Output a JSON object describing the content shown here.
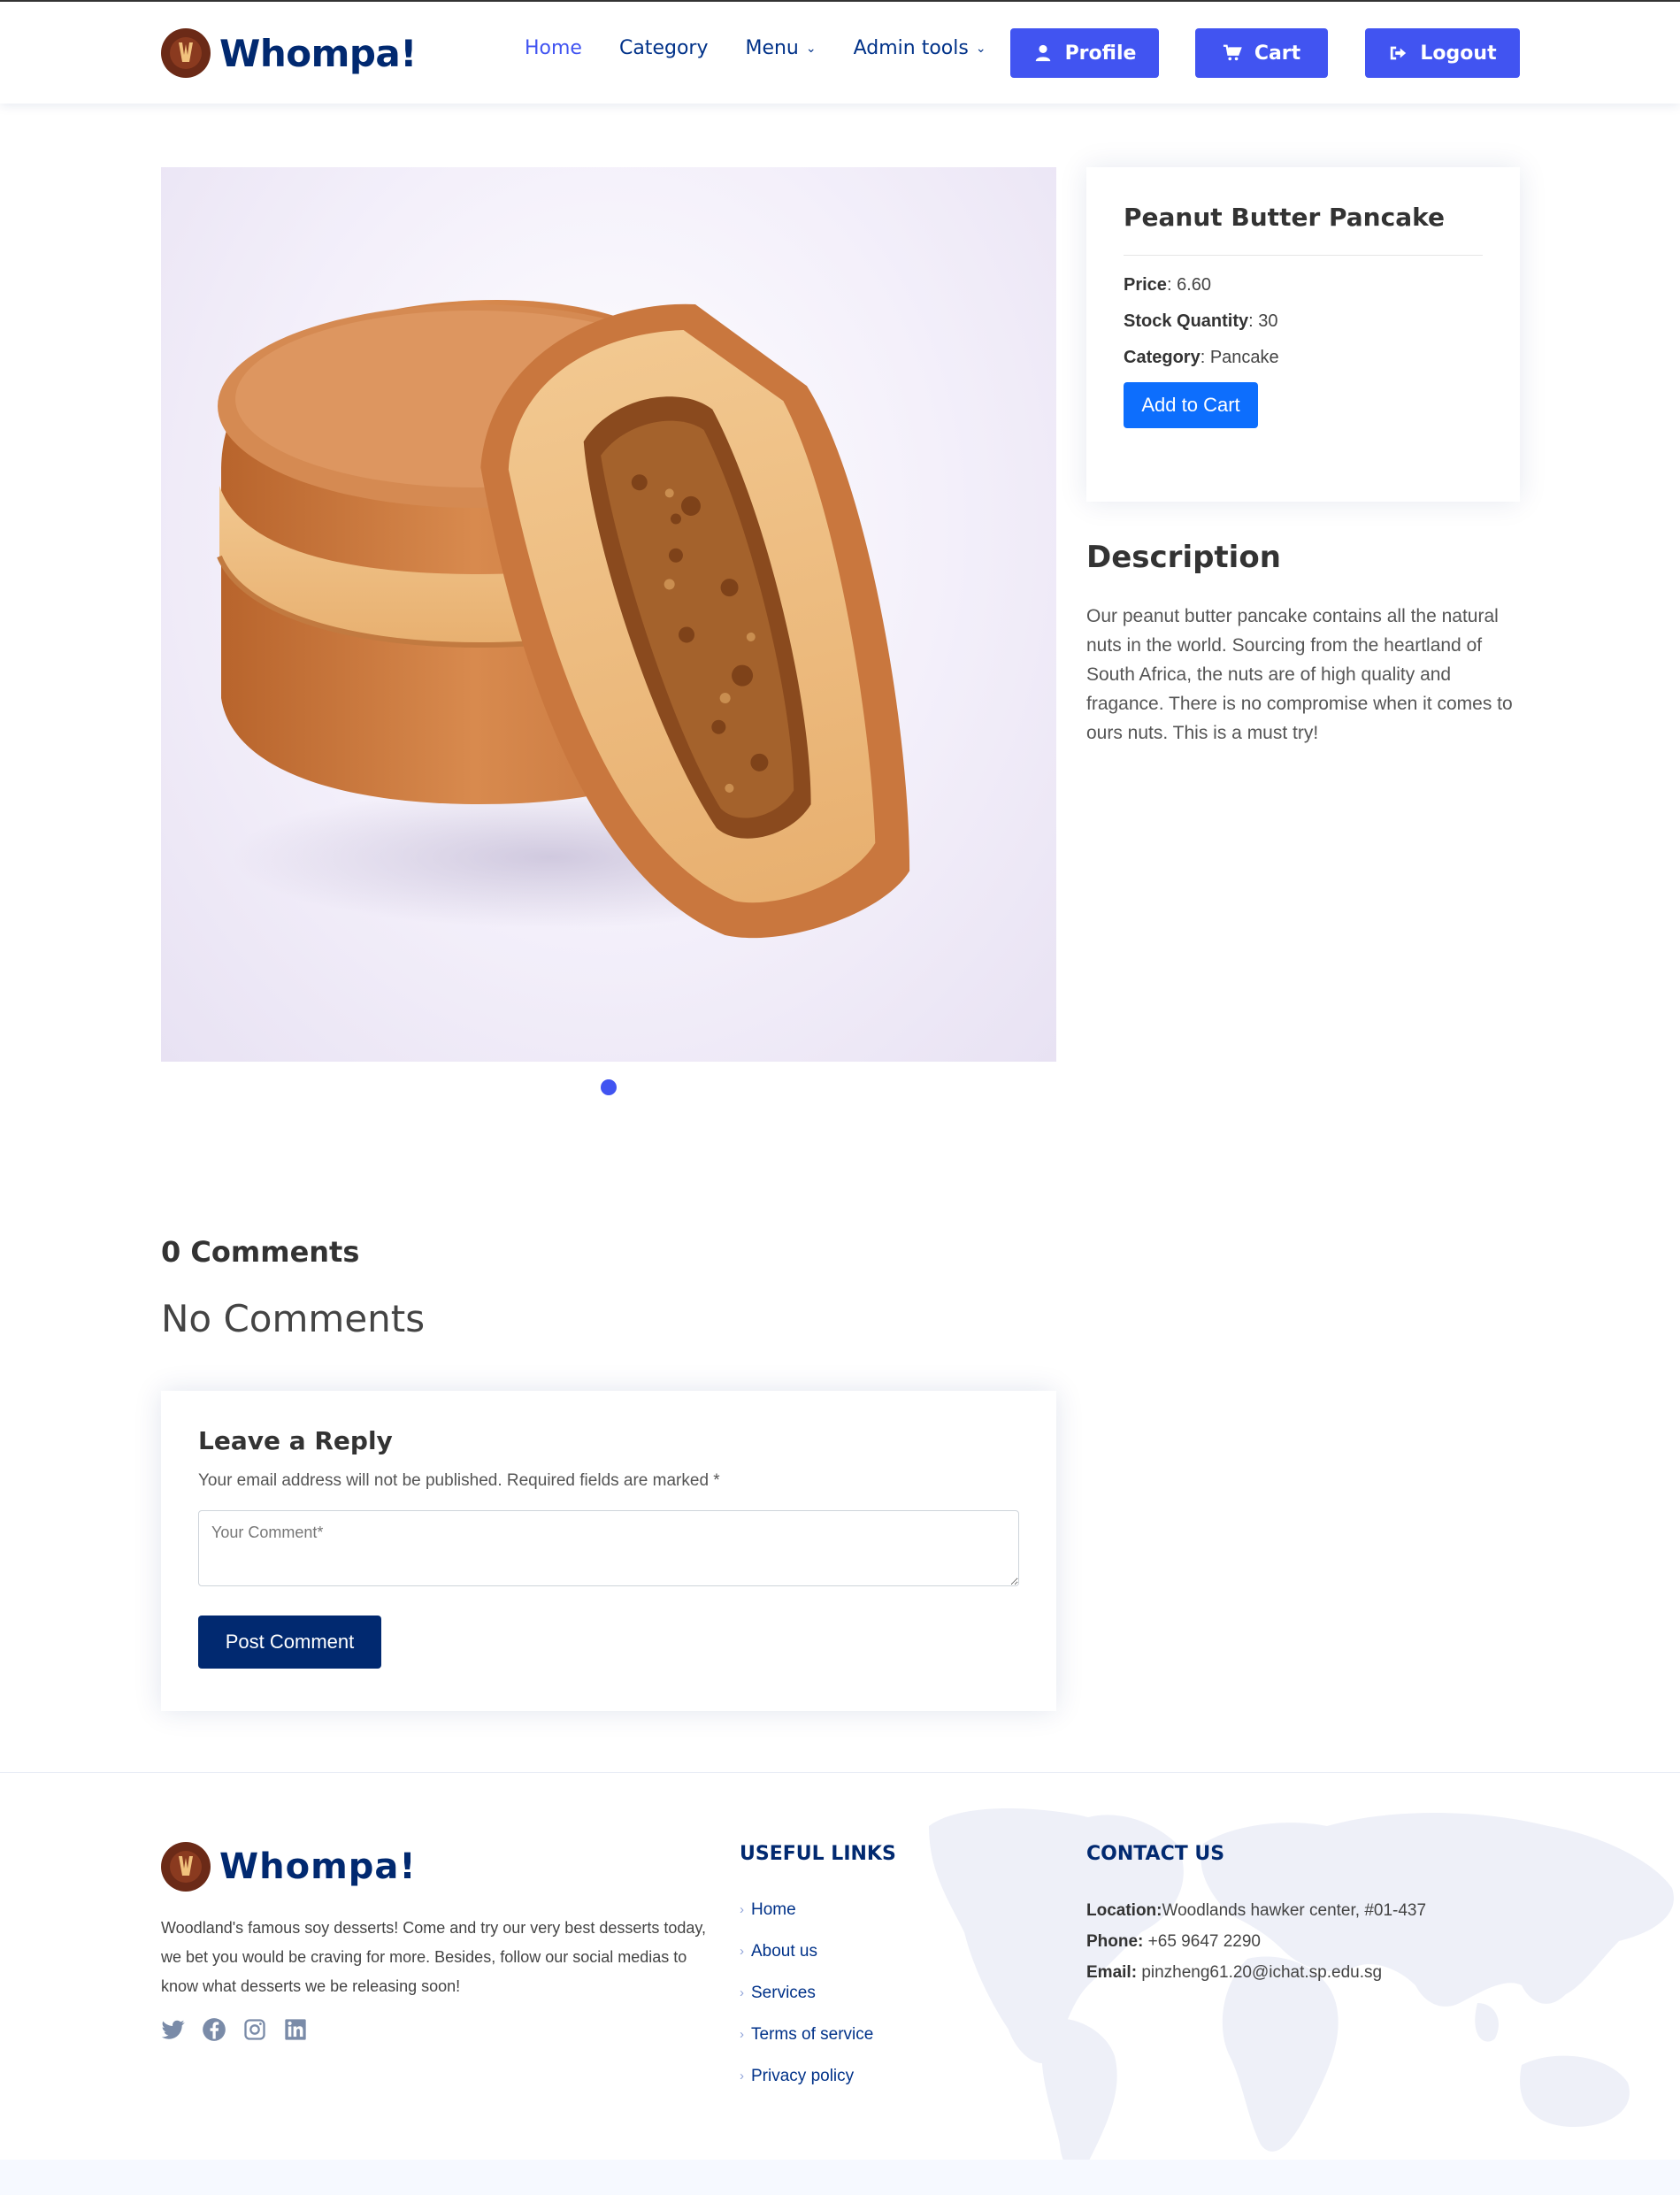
{
  "header": {
    "brand": "Whompa!",
    "nav": [
      {
        "label": "Home"
      },
      {
        "label": "Category"
      },
      {
        "label": "Menu"
      },
      {
        "label": "Admin tools"
      }
    ],
    "buttons": {
      "profile": "Profile",
      "cart": "Cart",
      "logout": "Logout"
    }
  },
  "product": {
    "name": "Peanut Butter Pancake",
    "price_label": "Price",
    "price": "6.60",
    "stock_label": "Stock Quantity",
    "stock": "30",
    "category_label": "Category",
    "category": "Pancake",
    "add_to_cart": "Add to Cart",
    "carousel_slides": 1,
    "carousel_active": 1
  },
  "description": {
    "title": "Description",
    "text": "Our peanut butter pancake contains all the natural nuts in the world. Sourcing from the heartland of South Africa, the nuts are of high quality and fragance. There is no compromise when it comes to ours nuts. This is a must try!"
  },
  "comments": {
    "count_label": "0 Comments",
    "empty_label": "No Comments"
  },
  "reply": {
    "title": "Leave a Reply",
    "note": "Your email address will not be published. Required fields are marked *",
    "placeholder": "Your Comment*",
    "submit": "Post Comment"
  },
  "footer": {
    "brand": "Whompa!",
    "about": "Woodland's famous soy desserts! Come and try our very best desserts today, we bet you would be craving for more. Besides, follow our social medias to know what desserts we be releasing soon!",
    "socials": [
      "twitter-icon",
      "facebook-icon",
      "instagram-icon",
      "linkedin-icon"
    ],
    "links_title": "USEFUL LINKS",
    "links": [
      "Home",
      "About us",
      "Services",
      "Terms of service",
      "Privacy policy"
    ],
    "contact_title": "CONTACT US",
    "location_label": "Location:",
    "location": "Woodlands hawker center, #01-437",
    "phone_label": "Phone:",
    "phone": "+65 9647 2290",
    "email_label": "Email:",
    "email": "pinzheng61.20@ichat.sp.edu.sg"
  },
  "colors": {
    "accent": "#4154f1",
    "navy": "#012970",
    "primary_button": "#0d6efd",
    "logo": "#6b2a17"
  }
}
